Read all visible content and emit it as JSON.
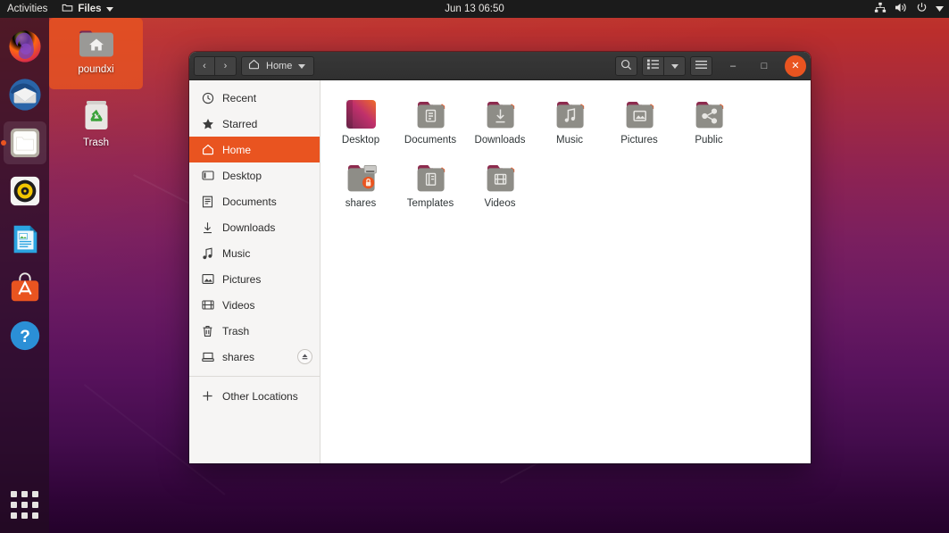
{
  "topbar": {
    "activities": "Activities",
    "app_menu": "Files",
    "app_menu_icon": "folder-icon",
    "clock": "Jun 13  06:50",
    "tray_icons": [
      "network-icon",
      "volume-icon",
      "power-icon",
      "chevron-down-icon"
    ]
  },
  "dock": {
    "items": [
      {
        "name": "firefox",
        "label": "Firefox",
        "active": false
      },
      {
        "name": "thunderbird",
        "label": "Thunderbird",
        "active": false
      },
      {
        "name": "files",
        "label": "Files",
        "active": true
      },
      {
        "name": "rhythmbox",
        "label": "Rhythmbox",
        "active": false
      },
      {
        "name": "libreoffice-writer",
        "label": "LibreOffice Writer",
        "active": false
      },
      {
        "name": "ubuntu-software",
        "label": "Ubuntu Software",
        "active": false
      },
      {
        "name": "help",
        "label": "Help",
        "active": false
      }
    ],
    "app_grid_label": "Show Applications"
  },
  "desktop_icons": [
    {
      "label": "poundxi",
      "icon": "home-folder-icon",
      "selected": true
    },
    {
      "label": "Trash",
      "icon": "trash-icon",
      "selected": false
    }
  ],
  "window": {
    "nav": {
      "back": "‹",
      "forward": "›"
    },
    "path_label": "Home",
    "path_icon": "home-icon",
    "path_dropdown": "chevron-down-icon",
    "search_icon": "search-icon",
    "view_list_icon": "list-view-icon",
    "view_dropdown_icon": "chevron-down-icon",
    "menu_icon": "hamburger-menu-icon",
    "minimize": "–",
    "maximize": "□",
    "close": "✕"
  },
  "sidebar": {
    "items": [
      {
        "label": "Recent",
        "icon": "clock-icon",
        "selected": false,
        "eject": false
      },
      {
        "label": "Starred",
        "icon": "star-icon",
        "selected": false,
        "eject": false
      },
      {
        "label": "Home",
        "icon": "home-icon",
        "selected": true,
        "eject": false
      },
      {
        "label": "Desktop",
        "icon": "desktop-icon",
        "selected": false,
        "eject": false
      },
      {
        "label": "Documents",
        "icon": "document-icon",
        "selected": false,
        "eject": false
      },
      {
        "label": "Downloads",
        "icon": "download-icon",
        "selected": false,
        "eject": false
      },
      {
        "label": "Music",
        "icon": "music-icon",
        "selected": false,
        "eject": false
      },
      {
        "label": "Pictures",
        "icon": "image-icon",
        "selected": false,
        "eject": false
      },
      {
        "label": "Videos",
        "icon": "video-icon",
        "selected": false,
        "eject": false
      },
      {
        "label": "Trash",
        "icon": "trash-icon",
        "selected": false,
        "eject": false
      },
      {
        "label": "shares",
        "icon": "drive-icon",
        "selected": false,
        "eject": true
      }
    ],
    "other_locations": {
      "label": "Other Locations",
      "icon": "plus-icon"
    }
  },
  "files": [
    {
      "label": "Desktop",
      "icon": "wallpaper-folder-icon"
    },
    {
      "label": "Documents",
      "icon": "documents-folder-icon"
    },
    {
      "label": "Downloads",
      "icon": "downloads-folder-icon"
    },
    {
      "label": "Music",
      "icon": "music-folder-icon"
    },
    {
      "label": "Pictures",
      "icon": "pictures-folder-icon"
    },
    {
      "label": "Public",
      "icon": "public-folder-icon"
    },
    {
      "label": "shares",
      "icon": "locked-drive-folder-icon"
    },
    {
      "label": "Templates",
      "icon": "templates-folder-icon"
    },
    {
      "label": "Videos",
      "icon": "videos-folder-icon"
    }
  ],
  "colors": {
    "accent": "#e95420",
    "topbar_bg": "#1b1b1b",
    "headerbar_bg": "#303030",
    "sidebar_bg": "#f6f5f4",
    "content_bg": "#ffffff"
  }
}
